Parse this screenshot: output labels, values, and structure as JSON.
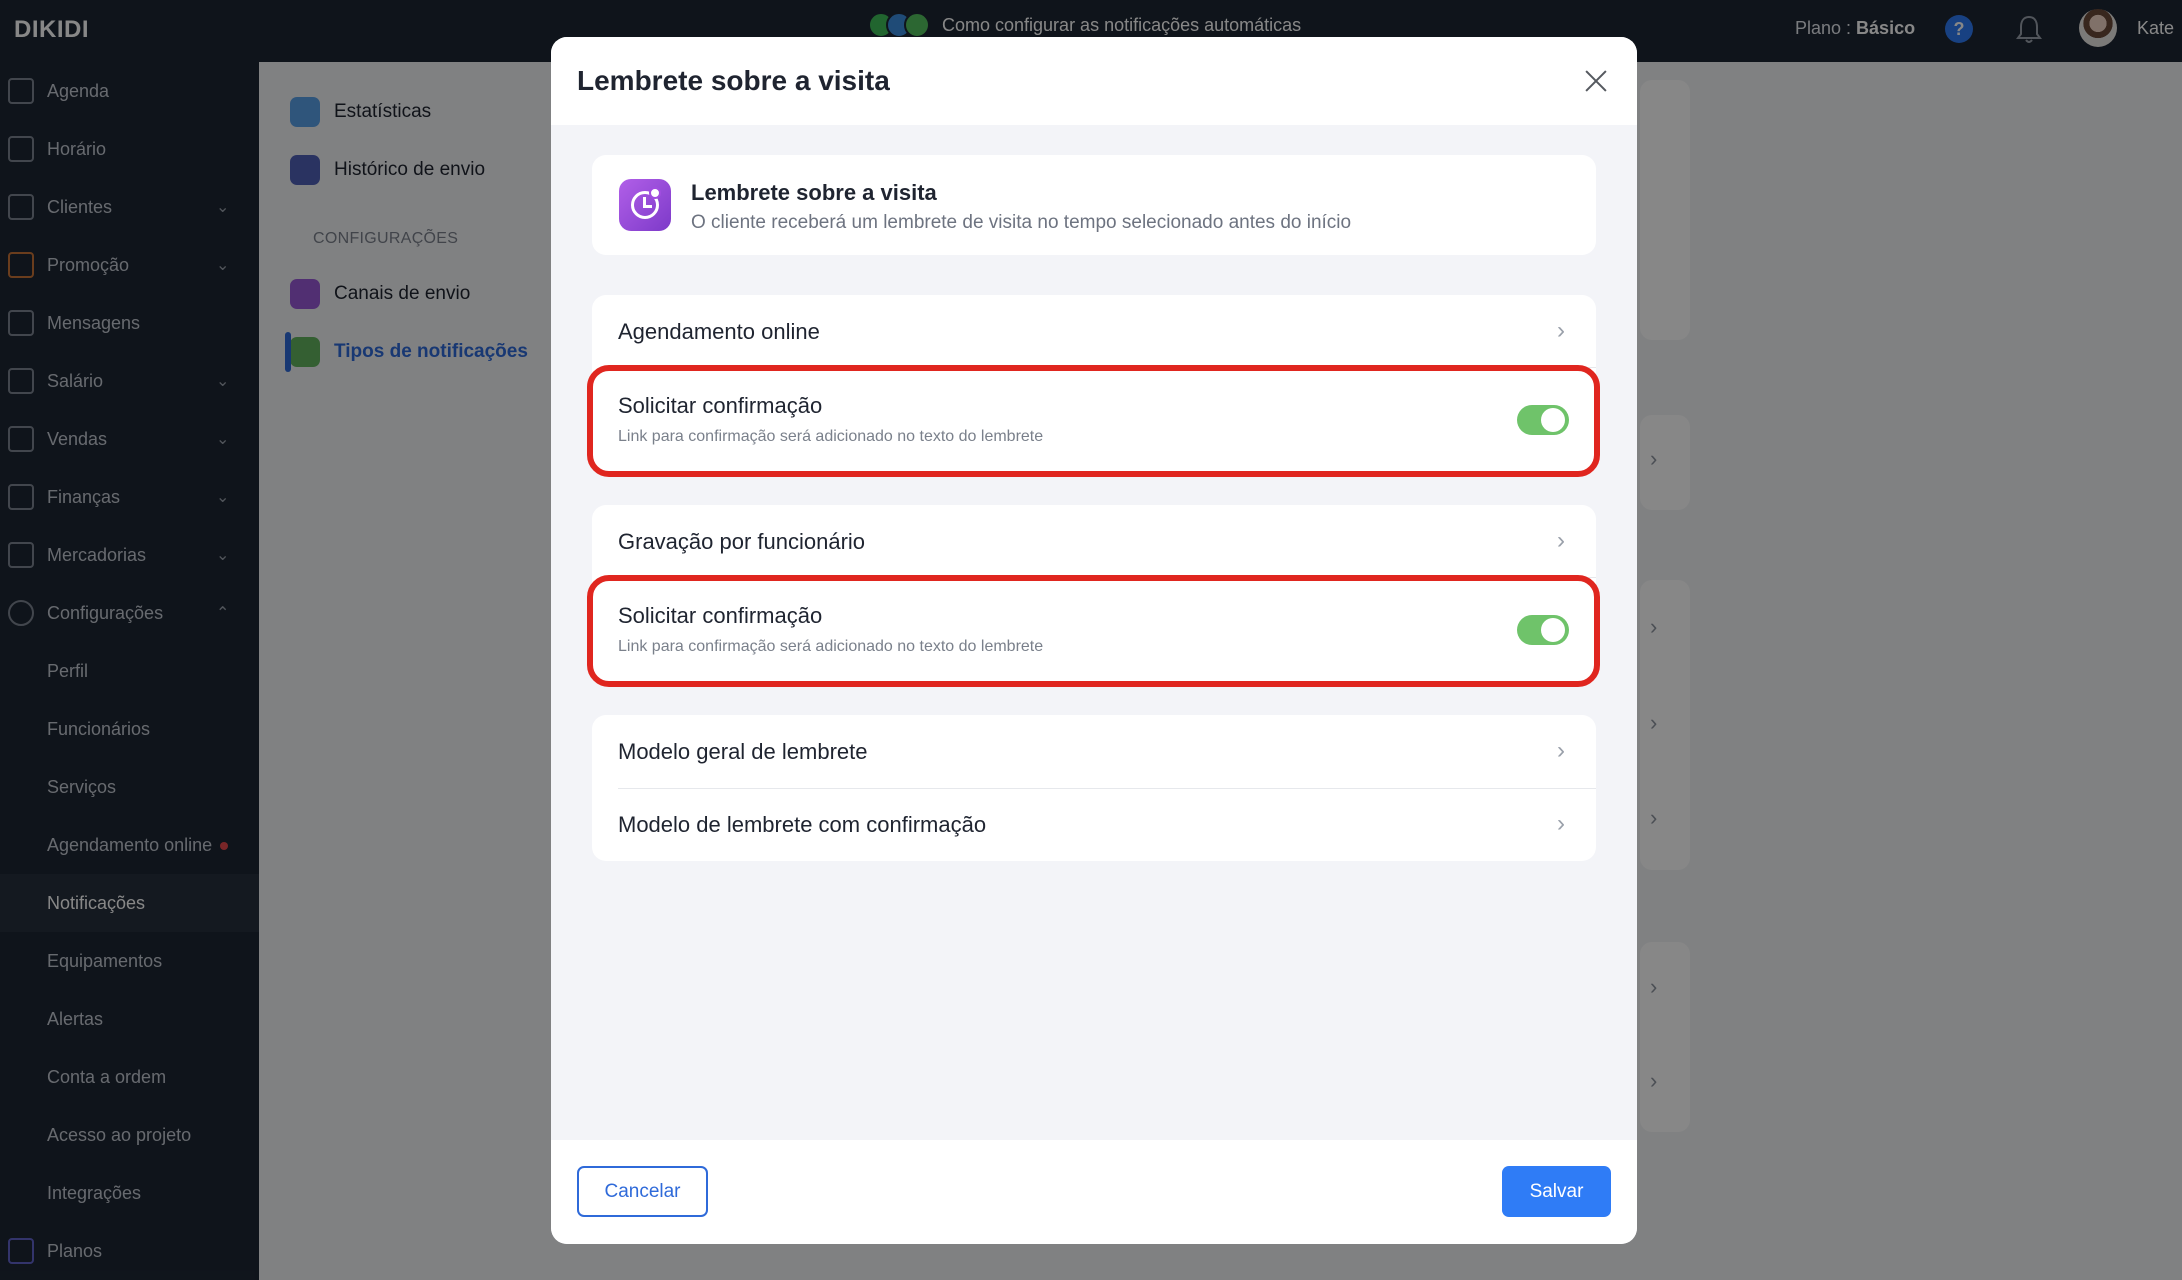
{
  "topbar": {
    "brand": "DIKIDI",
    "promo_text": "Como configurar as notificações automáticas",
    "plan_label": "Plano : ",
    "plan_value": "Básico",
    "help_label": "?",
    "user_name": "Kate"
  },
  "sidebar": {
    "items": [
      {
        "label": "Agenda",
        "icon": "calendar-icon"
      },
      {
        "label": "Horário",
        "icon": "schedule-icon"
      },
      {
        "label": "Clientes",
        "icon": "users-icon"
      },
      {
        "label": "Promoção",
        "icon": "rocket-icon"
      },
      {
        "label": "Mensagens",
        "icon": "chat-icon"
      },
      {
        "label": "Salário",
        "icon": "wallet-icon"
      },
      {
        "label": "Vendas",
        "icon": "receipt-icon"
      },
      {
        "label": "Finanças",
        "icon": "finance-icon"
      },
      {
        "label": "Mercadorias",
        "icon": "cart-icon"
      },
      {
        "label": "Configurações",
        "icon": "gear-icon"
      }
    ],
    "sub_items": [
      "Perfil",
      "Funcionários",
      "Serviços",
      "Agendamento online",
      "Notificações",
      "Equipamentos",
      "Alertas",
      "Conta a ordem",
      "Acesso ao projeto",
      "Integrações"
    ],
    "plans_label": "Planos"
  },
  "submenu": {
    "stats": "Estatísticas",
    "history": "Histórico de envio",
    "section": "CONFIGURAÇÕES",
    "channels": "Canais de envio",
    "types": "Tipos de notificações"
  },
  "modal": {
    "title": "Lembrete sobre a visita",
    "info": {
      "title": "Lembrete sobre a visita",
      "description": "O cliente receberá um lembrete de visita no tempo selecionado antes do início"
    },
    "rows": {
      "online_booking": "Agendamento online",
      "confirm_1": {
        "label": "Solicitar confirmação",
        "sub": "Link para confirmação será adicionado no texto do lembrete",
        "enabled": true
      },
      "employee_booking": "Gravação por funcionário",
      "confirm_2": {
        "label": "Solicitar confirmação",
        "sub": "Link para confirmação será adicionado no texto do lembrete",
        "enabled": true
      },
      "general_template": "Modelo geral de lembrete",
      "confirm_template": "Modelo de lembrete com confirmação"
    },
    "cancel": "Cancelar",
    "save": "Salvar"
  },
  "colors": {
    "accent": "#2f7cf6",
    "toggle_on": "#6fc36a",
    "highlight": "#e0261f",
    "sidebar_bg": "#1e2734"
  }
}
